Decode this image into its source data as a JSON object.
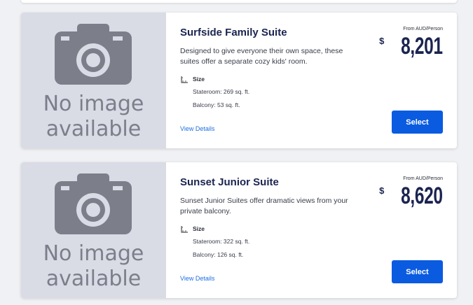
{
  "placeholder_image": {
    "line1": "No image",
    "line2": "available",
    "icon": "camera-icon"
  },
  "suites": [
    {
      "title": "Surfside Family Suite",
      "description": "Designed to give everyone their own space, these suites offer a separate cozy kids' room.",
      "size_label": "Size",
      "stateroom": "Stateroom: 269 sq. ft.",
      "balcony": "Balcony: 53 sq. ft.",
      "details_label": "View Details",
      "price_from": "From AUD/Person",
      "currency_symbol": "$",
      "price": "8,201",
      "select_label": "Select"
    },
    {
      "title": "Sunset Junior Suite",
      "description": "Sunset Junior Suites offer dramatic views from your private balcony.",
      "size_label": "Size",
      "stateroom": "Stateroom: 322 sq. ft.",
      "balcony": "Balcony: 126 sq. ft.",
      "details_label": "View Details",
      "price_from": "From AUD/Person",
      "currency_symbol": "$",
      "price": "8,620",
      "select_label": "Select"
    }
  ],
  "colors": {
    "accent": "#0a5be0",
    "title": "#1b2450",
    "link": "#1f6fe0",
    "placeholder_bg": "#d9dbe5",
    "placeholder_fg": "#7c7f8a"
  }
}
